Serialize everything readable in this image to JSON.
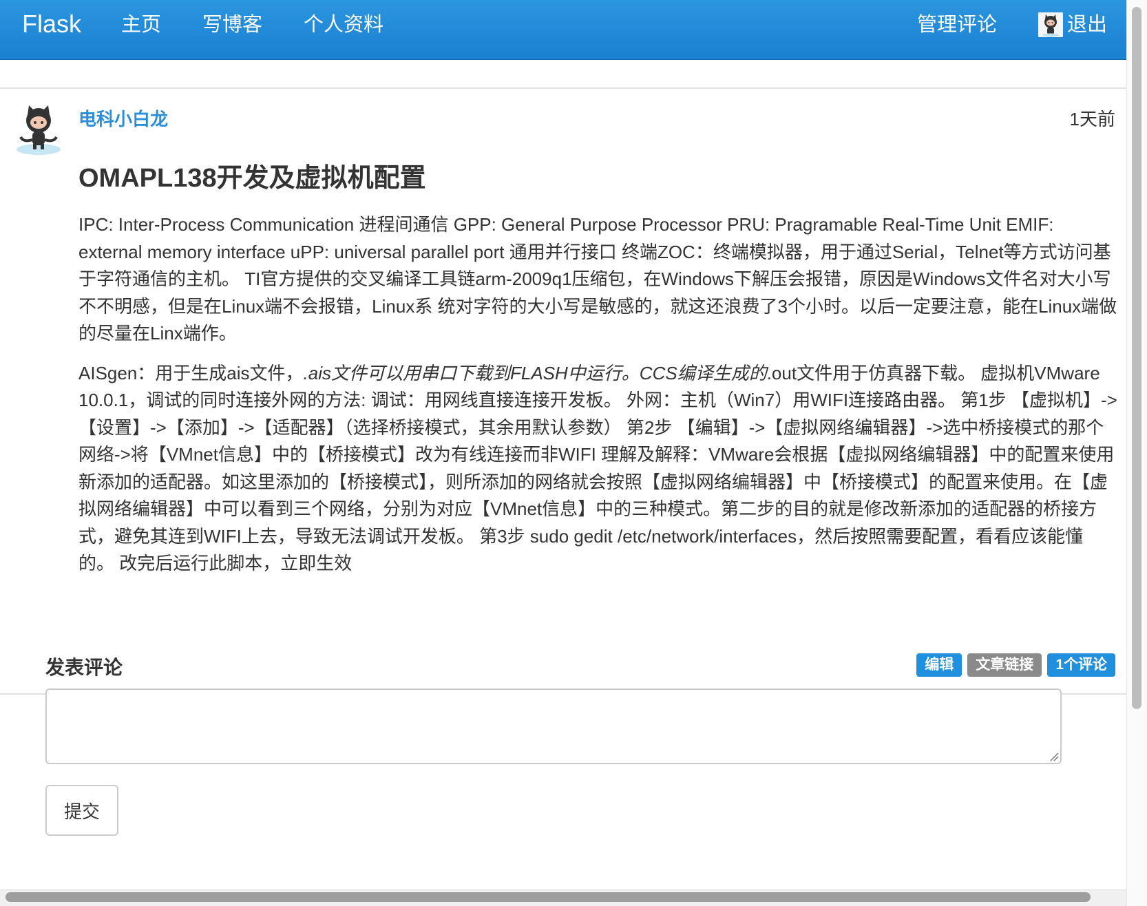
{
  "navbar": {
    "brand": "Flask",
    "items": [
      {
        "label": "主页"
      },
      {
        "label": "写博客"
      },
      {
        "label": "个人资料"
      }
    ],
    "moderate_label": "管理评论",
    "logout_label": "退出"
  },
  "post": {
    "author": "电科小白龙",
    "date": "1天前",
    "title": "OMAPL138开发及虚拟机配置",
    "paragraph1": "IPC: Inter-Process Communication 进程间通信 GPP: General Purpose Processor PRU: Pragramable Real-Time Unit EMIF: external memory interface uPP: universal parallel port 通用并行接口 终端ZOC：终端模拟器，用于通过Serial，Telnet等方式访问基于字符通信的主机。 TI官方提供的交叉编译工具链arm-2009q1压缩包，在Windows下解压会报错，原因是Windows文件名对大小写不不明感，但是在Linux端不会报错，Linux系 统对字符的大小写是敏感的，就这还浪费了3个小时。以后一定要注意，能在Linux端做的尽量在Linx端作。",
    "paragraph2_part1": "AISgen：用于生成ais文件，",
    "paragraph2_italic": ".ais文件可以用串口下载到FLASH中运行。CCS编译生成的",
    "paragraph2_part2": ".out文件用于仿真器下载。 虚拟机VMware 10.0.1，调试的同时连接外网的方法: 调试：用网线直接连接开发板。 外网：主机（Win7）用WIFI连接路由器。 第1步 【虚拟机】->【设置】->【添加】->【适配器】（选择桥接模式，其余用默认参数） 第2步 【编辑】->【虚拟网络编辑器】->选中桥接模式的那个网络->将【VMnet信息】中的【桥接模式】改为有线连接而非WIFI 理解及解释：VMware会根据【虚拟网络编辑器】中的配置来使用新添加的适配器。如这里添加的【桥接模式】，则所添加的网络就会按照【虚拟网络编辑器】中【桥接模式】的配置来使用。在【虚拟网络编辑器】中可以看到三个网络，分别为对应【VMnet信息】中的三种模式。第二步的目的就是修改新添加的适配器的桥接方式，避免其连到WIFI上去，导致无法调试开发板。 第3步 sudo gedit /etc/network/interfaces，然后按照需要配置，看看应该能懂的。 改完后运行此脚本，立即生效",
    "labels": {
      "edit": "编辑",
      "permalink": "文章链接",
      "comments": "1个评论"
    }
  },
  "comment_form": {
    "heading": "发表评论",
    "body_value": "",
    "submit_label": "提交"
  },
  "colors": {
    "navbar": "#1f8fde",
    "author_link": "#2a8fd8",
    "label_primary": "#1f8fde",
    "label_default": "#8a8a8a"
  },
  "icons": {
    "user_avatar": "octocat-avatar-icon",
    "nav_avatar": "octocat-avatar-icon"
  }
}
